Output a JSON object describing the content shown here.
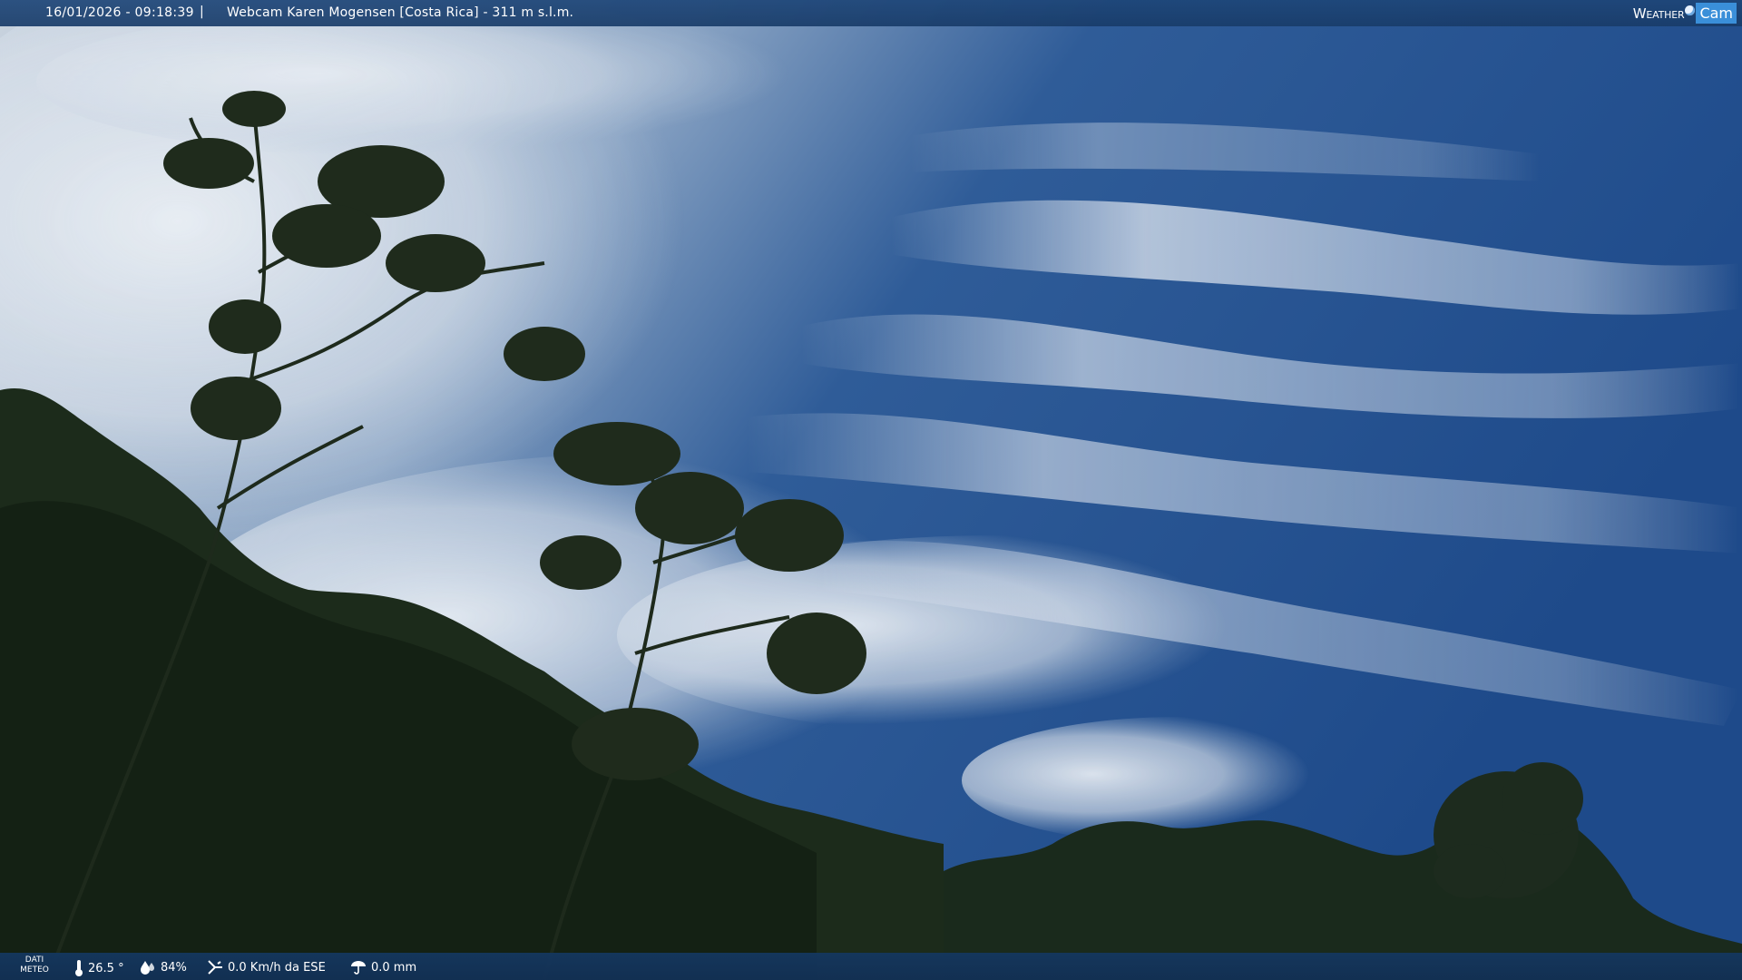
{
  "overlay_top": {
    "timestamp": "16/01/2026 - 09:18:39",
    "separator": "|",
    "title": "Webcam Karen Mogensen [Costa Rica]  - 311 m s.l.m.",
    "brand_weather": "Weather",
    "brand_cam": "Cam"
  },
  "overlay_bottom": {
    "label_line1": "DATI",
    "label_line2": "METEO",
    "temperature": "26.5 °",
    "humidity": "84%",
    "wind": "0.0 Km/h da ESE",
    "rain": "0.0 mm"
  },
  "icons": [
    "thermometer-icon",
    "humidity-drop-icon",
    "wind-icon",
    "rain-gauge-icon",
    "weathercam-logo"
  ],
  "colors": {
    "sky_deep": "#1f4d8f",
    "sky_mid": "#3d6aa8",
    "cloud": "#dfe7f0",
    "foliage": "#1b2a1a",
    "bar": "#1e4678"
  }
}
